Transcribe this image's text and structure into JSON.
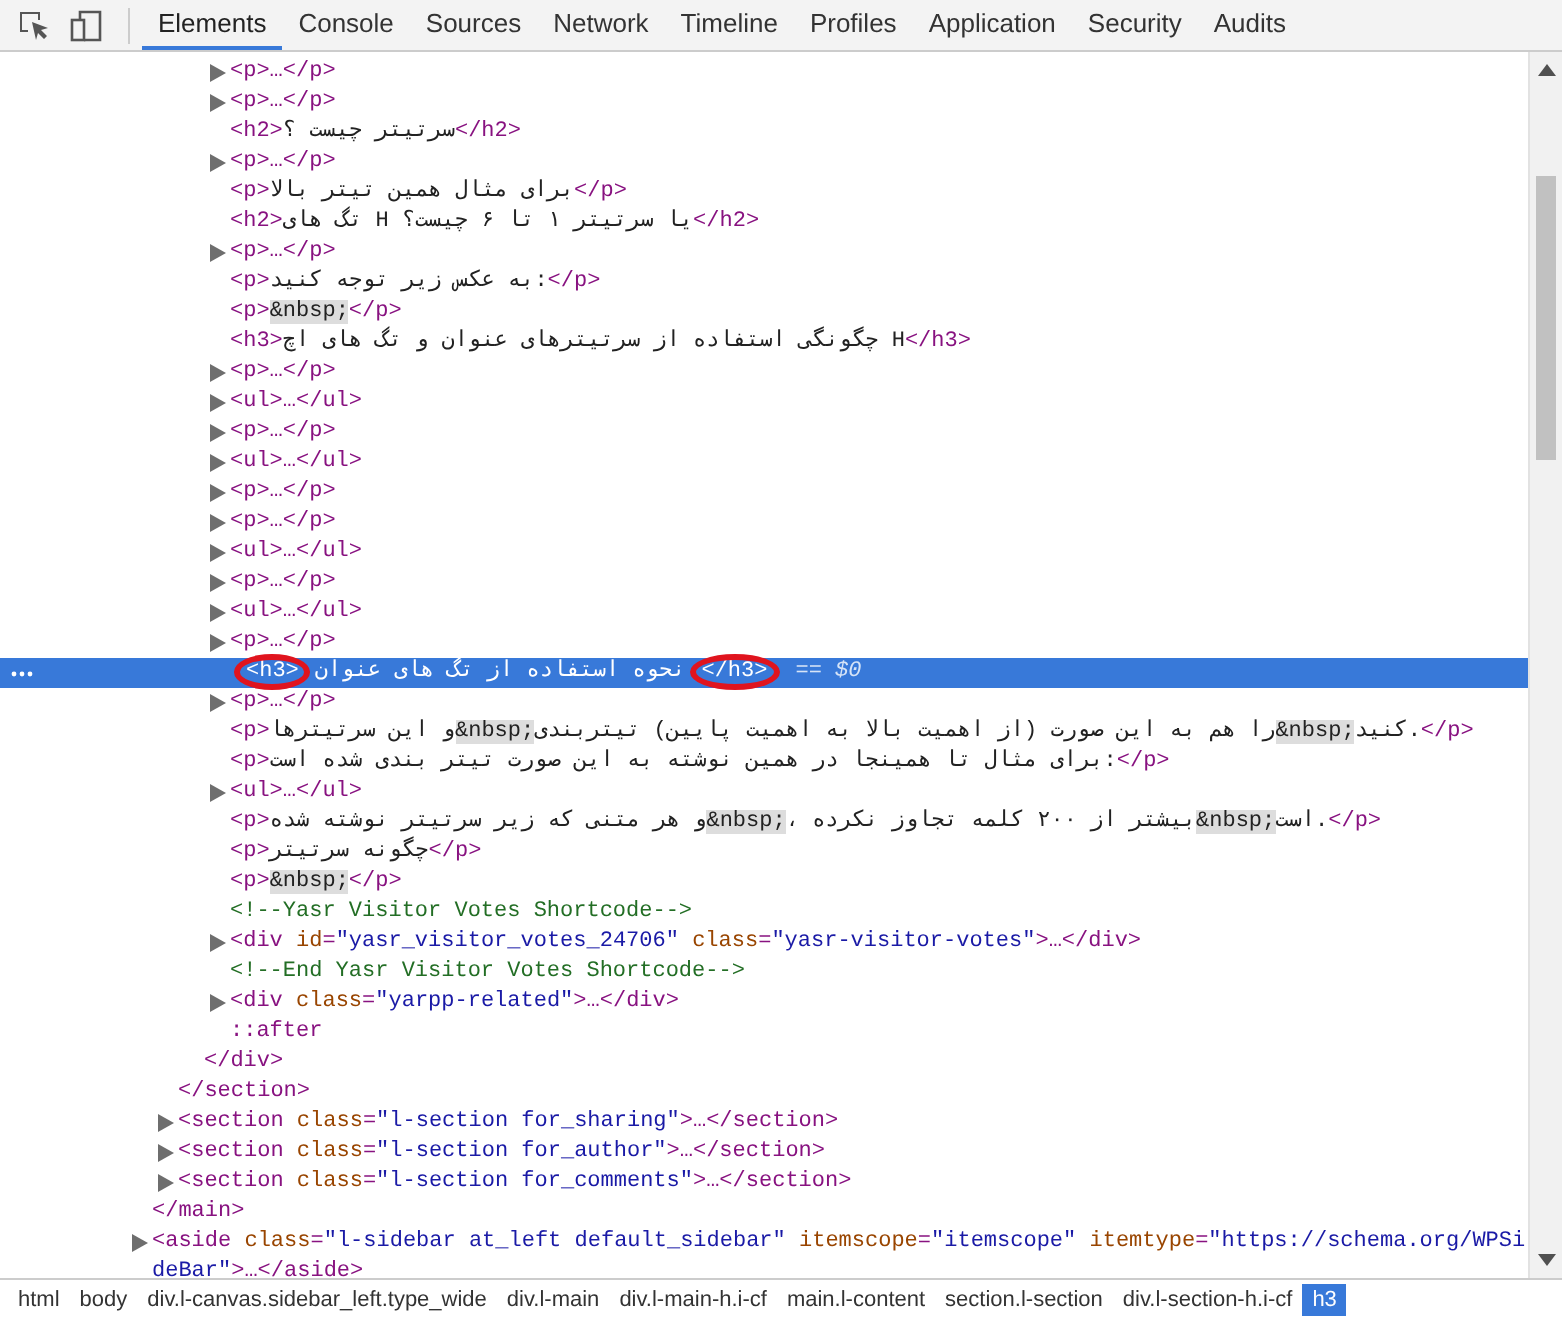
{
  "tabs": [
    {
      "label": "Elements",
      "selected": true
    },
    {
      "label": "Console",
      "selected": false
    },
    {
      "label": "Sources",
      "selected": false
    },
    {
      "label": "Network",
      "selected": false
    },
    {
      "label": "Timeline",
      "selected": false
    },
    {
      "label": "Profiles",
      "selected": false
    },
    {
      "label": "Application",
      "selected": false
    },
    {
      "label": "Security",
      "selected": false
    },
    {
      "label": "Audits",
      "selected": false
    }
  ],
  "dom": [
    {
      "close": [
        {
          "kind": "tag",
          "text": "</main>"
        }
      ],
      "children": [
        {
          "close": [
            {
              "kind": "tag",
              "text": "</section>"
            }
          ],
          "children": [
            {
              "close": [
                {
                  "kind": "tag",
                  "text": "</div>"
                }
              ],
              "children": [
                {
                  "selected": false,
                  "expandable": true,
                  "line": [
                    {
                      "kind": "tag",
                      "text": "<p>…</p>"
                    }
                  ]
                },
                {
                  "selected": false,
                  "expandable": true,
                  "line": [
                    {
                      "kind": "tag",
                      "text": "<p>…</p>"
                    }
                  ]
                },
                {
                  "selected": false,
                  "expandable": false,
                  "line": [
                    {
                      "kind": "tag",
                      "text": "<h2>"
                    },
                    {
                      "kind": "text",
                      "text": "سرتیتر چیست ؟"
                    },
                    {
                      "kind": "tag",
                      "text": "</h2>"
                    }
                  ]
                },
                {
                  "selected": false,
                  "expandable": true,
                  "line": [
                    {
                      "kind": "tag",
                      "text": "<p>…</p>"
                    }
                  ]
                },
                {
                  "selected": false,
                  "expandable": false,
                  "line": [
                    {
                      "kind": "tag",
                      "text": "<p>"
                    },
                    {
                      "kind": "text",
                      "text": "برای مثال همین تیتر بالا"
                    },
                    {
                      "kind": "tag",
                      "text": "</p>"
                    }
                  ]
                },
                {
                  "selected": false,
                  "expandable": false,
                  "line": [
                    {
                      "kind": "tag",
                      "text": "<h2>"
                    },
                    {
                      "kind": "text",
                      "text": "تگ های H یا سرتیتر ۱ تا ۶ چیست؟"
                    },
                    {
                      "kind": "tag",
                      "text": "</h2>"
                    }
                  ]
                },
                {
                  "selected": false,
                  "expandable": true,
                  "line": [
                    {
                      "kind": "tag",
                      "text": "<p>…</p>"
                    }
                  ]
                },
                {
                  "selected": false,
                  "expandable": false,
                  "line": [
                    {
                      "kind": "tag",
                      "text": "<p>"
                    },
                    {
                      "kind": "text",
                      "text": "به عکس زیر توجه کنید:"
                    },
                    {
                      "kind": "tag",
                      "text": "</p>"
                    }
                  ]
                },
                {
                  "selected": false,
                  "expandable": false,
                  "line": [
                    {
                      "kind": "tag",
                      "text": "<p>"
                    },
                    {
                      "kind": "nbsp",
                      "text": "&nbsp;"
                    },
                    {
                      "kind": "tag",
                      "text": "</p>"
                    }
                  ]
                },
                {
                  "selected": false,
                  "expandable": false,
                  "line": [
                    {
                      "kind": "tag",
                      "text": "<h3>"
                    },
                    {
                      "kind": "text",
                      "text": "چگونگی استفاده از سرتیترهای عنوان و تگ های اچ H"
                    },
                    {
                      "kind": "tag",
                      "text": "</h3>"
                    }
                  ]
                },
                {
                  "selected": false,
                  "expandable": true,
                  "line": [
                    {
                      "kind": "tag",
                      "text": "<p>…</p>"
                    }
                  ]
                },
                {
                  "selected": false,
                  "expandable": true,
                  "line": [
                    {
                      "kind": "tag",
                      "text": "<ul>…</ul>"
                    }
                  ]
                },
                {
                  "selected": false,
                  "expandable": true,
                  "line": [
                    {
                      "kind": "tag",
                      "text": "<p>…</p>"
                    }
                  ]
                },
                {
                  "selected": false,
                  "expandable": true,
                  "line": [
                    {
                      "kind": "tag",
                      "text": "<ul>…</ul>"
                    }
                  ]
                },
                {
                  "selected": false,
                  "expandable": true,
                  "line": [
                    {
                      "kind": "tag",
                      "text": "<p>…</p>"
                    }
                  ]
                },
                {
                  "selected": false,
                  "expandable": true,
                  "line": [
                    {
                      "kind": "tag",
                      "text": "<p>…</p>"
                    }
                  ]
                },
                {
                  "selected": false,
                  "expandable": true,
                  "line": [
                    {
                      "kind": "tag",
                      "text": "<ul>…</ul>"
                    }
                  ]
                },
                {
                  "selected": false,
                  "expandable": true,
                  "line": [
                    {
                      "kind": "tag",
                      "text": "<p>…</p>"
                    }
                  ]
                },
                {
                  "selected": false,
                  "expandable": true,
                  "line": [
                    {
                      "kind": "tag",
                      "text": "<ul>…</ul>"
                    }
                  ]
                },
                {
                  "selected": false,
                  "expandable": true,
                  "line": [
                    {
                      "kind": "tag",
                      "text": "<p>…</p>"
                    }
                  ]
                },
                {
                  "selected": true,
                  "expandable": false,
                  "ref": "== $0",
                  "line": [
                    {
                      "kind": "tag",
                      "text": "<h3>",
                      "circled": true
                    },
                    {
                      "kind": "text",
                      "text": "نحوه استفاده از تگ های عنوان",
                      "circled": false
                    },
                    {
                      "kind": "tag",
                      "text": "</h3>",
                      "circled": true
                    }
                  ]
                },
                {
                  "selected": false,
                  "expandable": true,
                  "line": [
                    {
                      "kind": "tag",
                      "text": "<p>…</p>"
                    }
                  ]
                },
                {
                  "selected": false,
                  "expandable": false,
                  "line": [
                    {
                      "kind": "tag",
                      "text": "<p>"
                    },
                    {
                      "kind": "text",
                      "text": "و این سرتیترها"
                    },
                    {
                      "kind": "nbsp",
                      "text": "&nbsp;"
                    },
                    {
                      "kind": "text",
                      "text": "را هم به این صورت (از اهمیت بالا به اهمیت پایین) تیتربندی"
                    },
                    {
                      "kind": "nbsp",
                      "text": "&nbsp;"
                    },
                    {
                      "kind": "text",
                      "text": "کنید."
                    },
                    {
                      "kind": "tag",
                      "text": "</p>"
                    }
                  ]
                },
                {
                  "selected": false,
                  "expandable": false,
                  "line": [
                    {
                      "kind": "tag",
                      "text": "<p>"
                    },
                    {
                      "kind": "text",
                      "text": "برای مثال تا همینجا در همین نوشته به این صورت تیتر بندی شده است:"
                    },
                    {
                      "kind": "tag",
                      "text": "</p>"
                    }
                  ]
                },
                {
                  "selected": false,
                  "expandable": true,
                  "line": [
                    {
                      "kind": "tag",
                      "text": "<ul>…</ul>"
                    }
                  ]
                },
                {
                  "selected": false,
                  "expandable": false,
                  "line": [
                    {
                      "kind": "tag",
                      "text": "<p>"
                    },
                    {
                      "kind": "text",
                      "text": "و هر متنی که زیر سرتیتر نوشته شده"
                    },
                    {
                      "kind": "nbsp",
                      "text": "&nbsp;"
                    },
                    {
                      "kind": "text",
                      "text": "، بیشتر از ۲۰۰ کلمه تجاوز نکرده"
                    },
                    {
                      "kind": "nbsp",
                      "text": "&nbsp;"
                    },
                    {
                      "kind": "text",
                      "text": "است."
                    },
                    {
                      "kind": "tag",
                      "text": "</p>"
                    }
                  ]
                },
                {
                  "selected": false,
                  "expandable": false,
                  "line": [
                    {
                      "kind": "tag",
                      "text": "<p>"
                    },
                    {
                      "kind": "text",
                      "text": "چگونه سرتیتر"
                    },
                    {
                      "kind": "tag",
                      "text": "</p>"
                    }
                  ]
                },
                {
                  "selected": false,
                  "expandable": false,
                  "line": [
                    {
                      "kind": "tag",
                      "text": "<p>"
                    },
                    {
                      "kind": "nbsp",
                      "text": "&nbsp;"
                    },
                    {
                      "kind": "tag",
                      "text": "</p>"
                    }
                  ]
                },
                {
                  "selected": false,
                  "expandable": false,
                  "line": [
                    {
                      "kind": "comment",
                      "text": "<!--Yasr Visitor Votes Shortcode-->"
                    }
                  ]
                },
                {
                  "selected": false,
                  "expandable": true,
                  "line": [
                    {
                      "kind": "tag",
                      "text": "<div "
                    },
                    {
                      "kind": "attr",
                      "text": "id"
                    },
                    {
                      "kind": "tag",
                      "text": "="
                    },
                    {
                      "kind": "value",
                      "text": "\"yasr_visitor_votes_24706\""
                    },
                    {
                      "kind": "attr",
                      "text": " class"
                    },
                    {
                      "kind": "tag",
                      "text": "="
                    },
                    {
                      "kind": "value",
                      "text": "\"yasr-visitor-votes\""
                    },
                    {
                      "kind": "tag",
                      "text": ">…</div>"
                    }
                  ]
                },
                {
                  "selected": false,
                  "expandable": false,
                  "line": [
                    {
                      "kind": "comment",
                      "text": "<!--End Yasr Visitor Votes Shortcode-->"
                    }
                  ]
                },
                {
                  "selected": false,
                  "expandable": true,
                  "line": [
                    {
                      "kind": "tag",
                      "text": "<div "
                    },
                    {
                      "kind": "attr",
                      "text": "class"
                    },
                    {
                      "kind": "tag",
                      "text": "="
                    },
                    {
                      "kind": "value",
                      "text": "\"yarpp-related\""
                    },
                    {
                      "kind": "tag",
                      "text": ">…</div>"
                    }
                  ]
                },
                {
                  "selected": false,
                  "expandable": false,
                  "line": [
                    {
                      "kind": "pseudo",
                      "text": "::after"
                    }
                  ]
                }
              ]
            }
          ]
        },
        {
          "selected": false,
          "expandable": true,
          "line": [
            {
              "kind": "tag",
              "text": "<section "
            },
            {
              "kind": "attr",
              "text": "class"
            },
            {
              "kind": "tag",
              "text": "="
            },
            {
              "kind": "value",
              "text": "\"l-section for_sharing\""
            },
            {
              "kind": "tag",
              "text": ">…</section>"
            }
          ]
        },
        {
          "selected": false,
          "expandable": true,
          "line": [
            {
              "kind": "tag",
              "text": "<section "
            },
            {
              "kind": "attr",
              "text": "class"
            },
            {
              "kind": "tag",
              "text": "="
            },
            {
              "kind": "value",
              "text": "\"l-section for_author\""
            },
            {
              "kind": "tag",
              "text": ">…</section>"
            }
          ]
        },
        {
          "selected": false,
          "expandable": true,
          "line": [
            {
              "kind": "tag",
              "text": "<section "
            },
            {
              "kind": "attr",
              "text": "class"
            },
            {
              "kind": "tag",
              "text": "="
            },
            {
              "kind": "value",
              "text": "\"l-section for_comments\""
            },
            {
              "kind": "tag",
              "text": ">…</section>"
            }
          ]
        }
      ]
    },
    {
      "selected": false,
      "expandable": true,
      "line": [
        {
          "kind": "tag",
          "text": "<aside "
        },
        {
          "kind": "attr",
          "text": "class"
        },
        {
          "kind": "tag",
          "text": "="
        },
        {
          "kind": "value",
          "text": "\"l-sidebar at_left default_sidebar\""
        },
        {
          "kind": "attr",
          "text": " itemscope"
        },
        {
          "kind": "tag",
          "text": "="
        },
        {
          "kind": "value",
          "text": "\"itemscope\""
        },
        {
          "kind": "attr",
          "text": " itemtype"
        },
        {
          "kind": "tag",
          "text": "="
        },
        {
          "kind": "value",
          "text": "\"https://schema.org/WPSideBar\""
        },
        {
          "kind": "tag",
          "text": ">…</aside>"
        }
      ]
    }
  ],
  "breadcrumbs": [
    {
      "label": "html",
      "selected": false
    },
    {
      "label": "body",
      "selected": false
    },
    {
      "label": "div.l-canvas.sidebar_left.type_wide",
      "selected": false
    },
    {
      "label": "div.l-main",
      "selected": false
    },
    {
      "label": "div.l-main-h.i-cf",
      "selected": false
    },
    {
      "label": "main.l-content",
      "selected": false
    },
    {
      "label": "section.l-section",
      "selected": false
    },
    {
      "label": "div.l-section-h.i-cf",
      "selected": false
    },
    {
      "label": "h3",
      "selected": true
    }
  ]
}
